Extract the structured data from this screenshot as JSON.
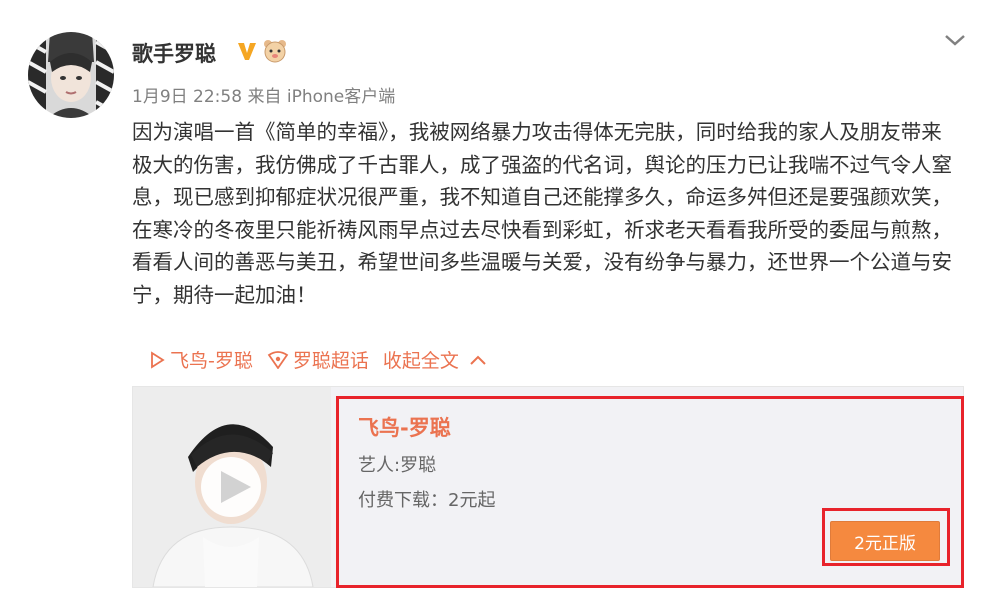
{
  "post": {
    "username": "歌手罗聪",
    "date": "1月9日 22:58",
    "source_prefix": "来自",
    "source_app": "iPhone客户端",
    "verified": true,
    "body": "因为演唱一首《简单的幸福》，我被网络暴力攻击得体无完肤，同时给我的家人及朋友带来极大的伤害，我仿佛成了千古罪人，成了强盗的代名词，舆论的压力已让我喘不过气令人窒息，现已感到抑郁症状况很严重，我不知道自己还能撑多久，命运多舛但还是要强颜欢笑，在寒冷的冬夜里只能祈祷风雨早点过去尽快看到彩虹，祈求老天看看我所受的委屈与煎熬，看看人间的善恶与美丑，希望世间多些温暖与关爱，没有纷争与暴力，还世界一个公道与安宁，期待一起加油！"
  },
  "links": {
    "music": "飞鸟-罗聪",
    "supertopic": "罗聪超话",
    "collapse": "收起全文"
  },
  "music_card": {
    "title": "飞鸟-罗聪",
    "artist": "艺人:罗聪",
    "price": "付费下载：2元起",
    "buy_button": "2元正版"
  },
  "icons": {
    "verified": "verified-v-badge-icon",
    "emoji": "hamster-emoji-icon",
    "dropdown": "chevron-down-icon",
    "music_link": "play-triangle-icon",
    "supertopic": "supertopic-icon",
    "collapse": "chevron-up-icon",
    "cover_play": "play-button-icon"
  },
  "colors": {
    "accent": "#eb7350",
    "highlight_border": "#e8232b",
    "buy_button": "#f5893f",
    "verified": "#f5a623",
    "meta_text": "#808080"
  }
}
